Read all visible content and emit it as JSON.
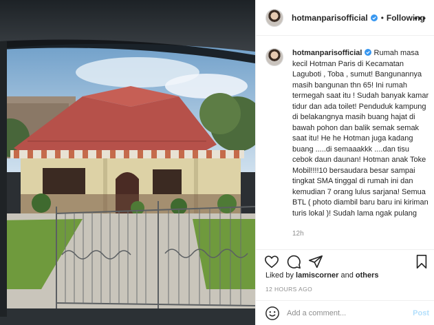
{
  "header": {
    "username": "hotmanparisofficial",
    "separator": "•",
    "follow_label": "Following",
    "more_label": "•••"
  },
  "caption": {
    "username": "hotmanparisofficial",
    "text": "Rumah masa kecil Hotman Paris di Kecamatan Laguboti , Toba , sumut! Bangunannya masih bangunan thn 65! Ini rumah termegah saat itu ! Sudah banyak kamar tidur dan ada toilet! Penduduk kampung di belakangnya masih buang hajat di bawah pohon dan balik semak semak saat itu! He he Hotman juga kadang buang .....di semaaakkk ....dan tisu cebok daun daunan! Hotman anak Toke Mobil!!!!10 bersaudara besar sampai tingkat SMA tinggal di rumah ini dan kemudian 7 orang lulus sarjana! Semua BTL ( photo diambil baru baru ini kiriman turis lokal )! Sudah lama ngak pulang",
    "time_ago": "12h"
  },
  "actions": {
    "icons": [
      "heart-icon",
      "comment-icon",
      "share-icon",
      "bookmark-icon"
    ]
  },
  "likes": {
    "prefix": "Liked by ",
    "user": "lamiscorner",
    "middle": " and ",
    "others": "others"
  },
  "post_date": "12 HOURS AGO",
  "comment_box": {
    "placeholder": "Add a comment...",
    "post_label": "Post"
  },
  "colors": {
    "verified_blue": "#3897f0",
    "post_disabled": "#b2dffc",
    "muted_text": "#8e8e8e"
  }
}
